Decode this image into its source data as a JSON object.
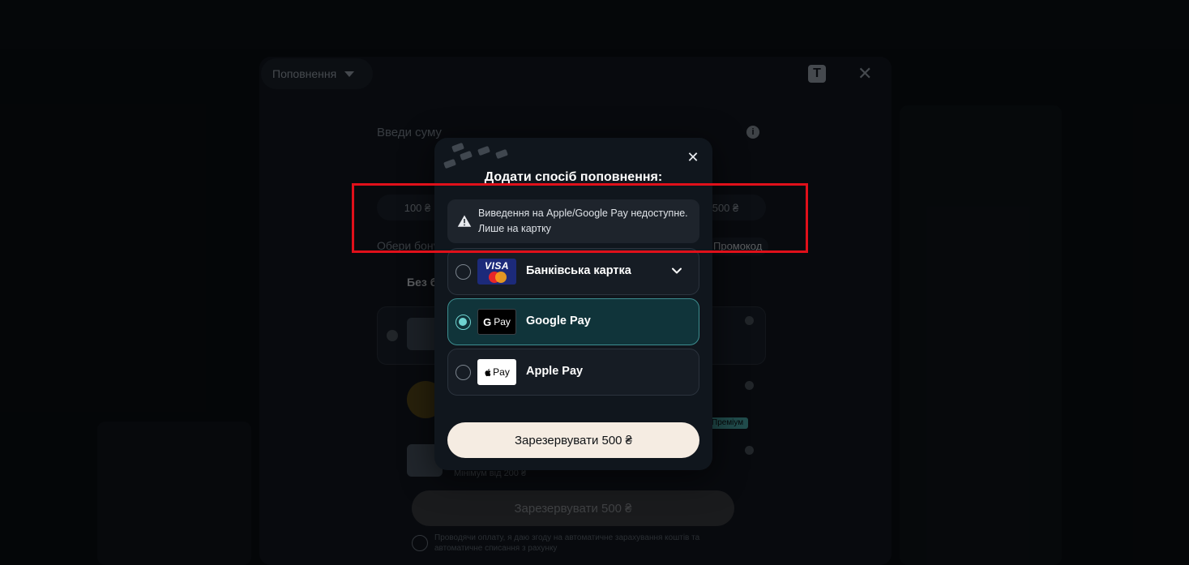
{
  "background": {
    "deposit_dropdown_label": "Поповнення",
    "sum_label": "Введи суму",
    "amount_chips": [
      "100 ₴",
      "500 ₴"
    ],
    "bonus_label": "Обери бонус",
    "promo_label": "Промокод",
    "no_bonus_label": "Без бонусу",
    "tag_label": "Преміум",
    "small_text": "Мінімум від 200 ₴",
    "reserve_label": "Зарезервувати 500 ₴",
    "terms_text": "Проводячи оплату, я даю згоду на автоматичне зарахування коштів та автоматичне списання з рахунку"
  },
  "modal": {
    "title": "Додати спосіб поповнення:",
    "close_label": "✕",
    "alert_text": "Виведення на Apple/Google Pay недоступне. Лише на картку",
    "payment_methods": [
      {
        "label": "Банківська картка",
        "logo": "visa-mastercard-icon",
        "selected": false,
        "expandable": true
      },
      {
        "label": "Google Pay",
        "logo": "google-pay-icon",
        "selected": true,
        "expandable": false
      },
      {
        "label": "Apple Pay",
        "logo": "apple-pay-icon",
        "selected": false,
        "expandable": false
      }
    ],
    "logo_text": {
      "visa": "VISA",
      "gpay": "Pay",
      "gpay_g": "G",
      "apay": "Pay",
      "apple": ""
    },
    "reserve_label": "Зарезервувати 500 ₴"
  },
  "colors": {
    "accent_selected": "#6fd3d0",
    "selected_bg": "#10343a",
    "cta_bg": "#f5ece2",
    "highlight": "#e0101a"
  }
}
